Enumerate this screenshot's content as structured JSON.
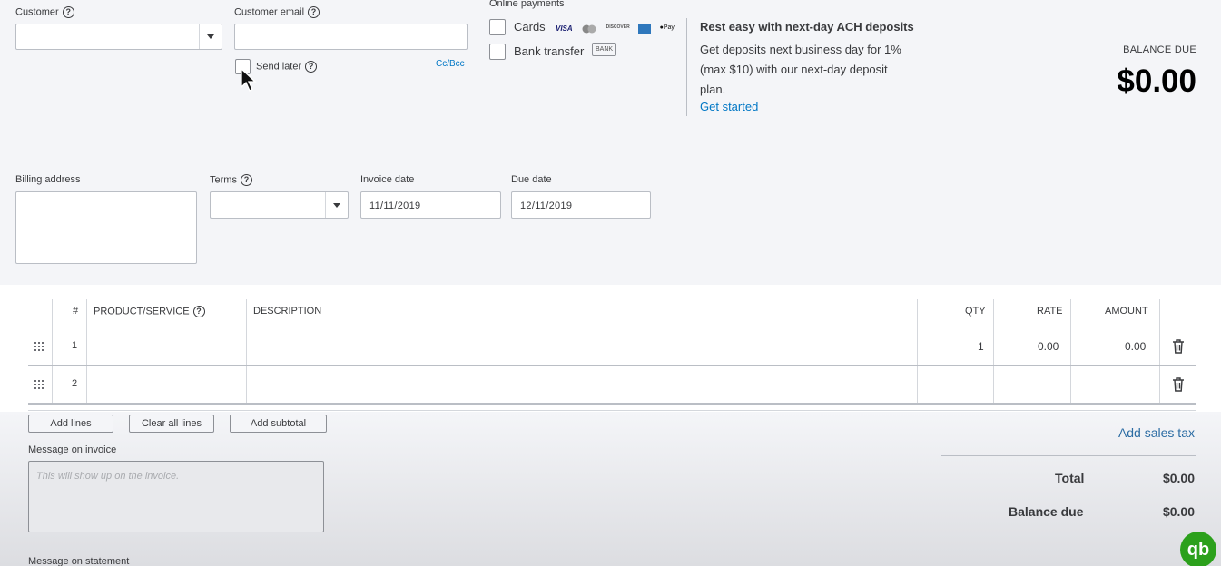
{
  "customer": {
    "label": "Customer",
    "value": ""
  },
  "customer_email": {
    "label": "Customer email",
    "value": "",
    "send_later_label": "Send later",
    "cc_bcc": "Cc/Bcc"
  },
  "online_payments": {
    "label": "Online payments",
    "cards_label": "Cards",
    "bank_transfer_label": "Bank transfer",
    "bank_badge": "BANK",
    "card_brands": [
      "VISA",
      "MC",
      "DISCOVER",
      "AMEX",
      "Pay"
    ]
  },
  "promo": {
    "title": "Rest easy with next-day ACH deposits",
    "line1": "Get deposits next business day for 1%",
    "line2": "(max $10) with our next-day deposit",
    "line3": "plan.",
    "link": "Get started"
  },
  "balance": {
    "label": "BALANCE DUE",
    "amount": "$0.00"
  },
  "billing_address": {
    "label": "Billing address",
    "value": ""
  },
  "terms": {
    "label": "Terms",
    "value": ""
  },
  "invoice_date": {
    "label": "Invoice date",
    "value": "11/11/2019"
  },
  "due_date": {
    "label": "Due date",
    "value": "12/11/2019"
  },
  "table": {
    "headers": {
      "num": "#",
      "product": "PRODUCT/SERVICE",
      "description": "DESCRIPTION",
      "qty": "QTY",
      "rate": "RATE",
      "amount": "AMOUNT"
    },
    "rows": [
      {
        "num": "1",
        "product": "",
        "description": "",
        "qty": "1",
        "rate": "0.00",
        "amount": "0.00"
      },
      {
        "num": "2",
        "product": "",
        "description": "",
        "qty": "",
        "rate": "",
        "amount": ""
      }
    ]
  },
  "buttons": {
    "add_lines": "Add lines",
    "clear_all_lines": "Clear all lines",
    "add_subtotal": "Add subtotal"
  },
  "add_sales_tax": "Add sales tax",
  "message_on_invoice": {
    "label": "Message on invoice",
    "placeholder": "This will show up on the invoice."
  },
  "message_on_statement": {
    "label": "Message on statement"
  },
  "totals": {
    "total_label": "Total",
    "total_value": "$0.00",
    "balance_due_label": "Balance due",
    "balance_due_value": "$0.00"
  },
  "logo_text": "qb",
  "colors": {
    "link": "#0077c5",
    "brand_green": "#2ca01c"
  }
}
